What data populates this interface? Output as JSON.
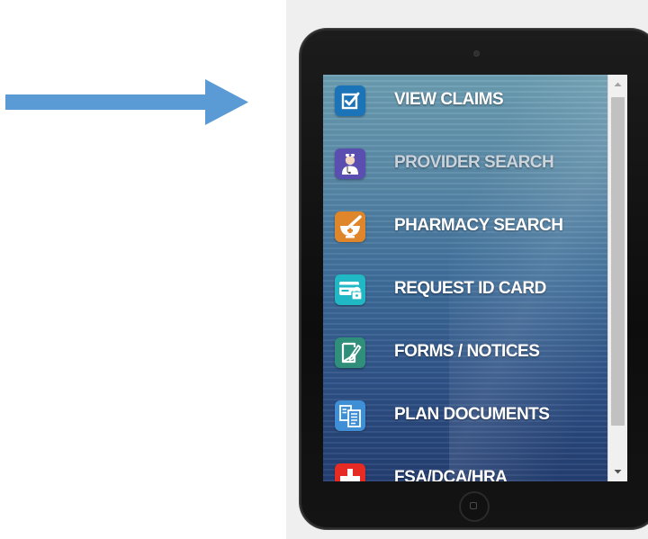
{
  "menu": {
    "items": [
      {
        "label": "VIEW CLAIMS",
        "icon": "checkbox-icon",
        "color": "#1b73b8",
        "text_color": "#ffffff"
      },
      {
        "label": "PROVIDER SEARCH",
        "icon": "doctor-icon",
        "color": "#5a4fb0",
        "text_color": "#c9d2da"
      },
      {
        "label": "PHARMACY SEARCH",
        "icon": "mortar-pestle-icon",
        "color": "#e0862a",
        "text_color": "#ffffff"
      },
      {
        "label": "REQUEST ID CARD",
        "icon": "id-card-lock-icon",
        "color": "#1fb8c4",
        "text_color": "#ffffff"
      },
      {
        "label": "FORMS / NOTICES",
        "icon": "form-pencil-icon",
        "color": "#2f8f7a",
        "text_color": "#ffffff"
      },
      {
        "label": "PLAN DOCUMENTS",
        "icon": "documents-icon",
        "color": "#3f8fd6",
        "text_color": "#ffffff"
      },
      {
        "label": "FSA/DCA/HRA",
        "icon": "medical-cross-icon",
        "color": "#e52b24",
        "text_color": "#ffffff"
      }
    ]
  },
  "colors": {
    "arrow": "#5b9bd5",
    "frame": "#efefef",
    "tablet": "#111111"
  }
}
